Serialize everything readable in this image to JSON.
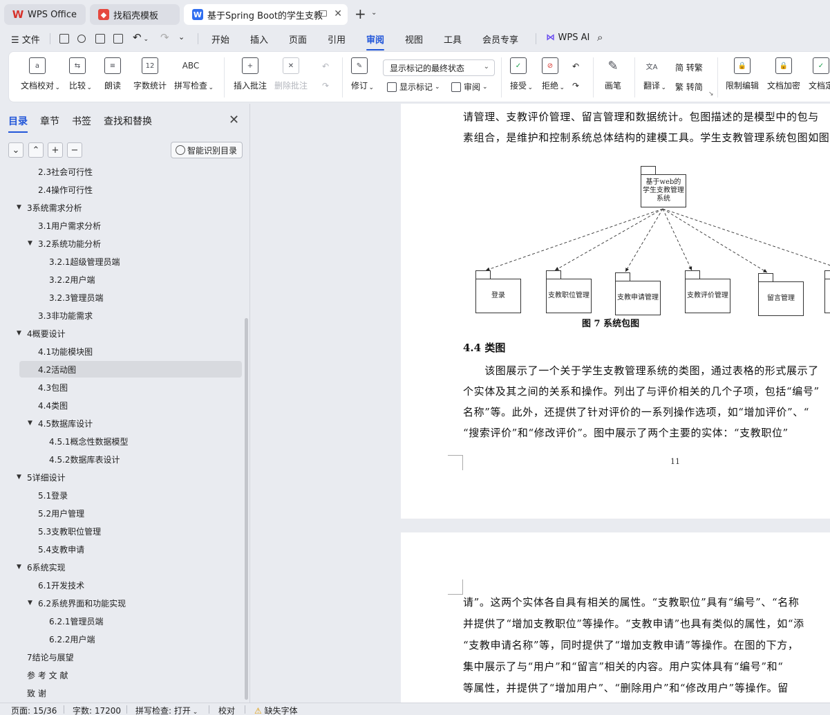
{
  "tabs": {
    "wps_office": "WPS Office",
    "templates": "找稻壳模板",
    "document": "基于Spring Boot的学生支教管"
  },
  "menu": {
    "file": "文件",
    "items": [
      "开始",
      "插入",
      "页面",
      "引用",
      "审阅",
      "视图",
      "工具",
      "会员专享"
    ],
    "active": "审阅",
    "wps_ai": "WPS AI"
  },
  "ribbon": {
    "doc_check": "文档校对",
    "compare": "比较",
    "read_aloud": "朗读",
    "word_count": "字数统计",
    "word_count_icon_text": "12",
    "spell_check": "拼写检查",
    "spell_icon_text": "ABC",
    "insert_comment": "插入批注",
    "delete_comment": "删除批注",
    "revise": "修订",
    "mark_state": "显示标记的最终状态",
    "show_marks": "显示标记",
    "review": "审阅",
    "accept": "接受",
    "reject": "拒绝",
    "pen": "画笔",
    "translate": "翻译",
    "to_traditional": "简 转繁",
    "to_simplified": "繁 转简",
    "restrict_edit": "限制编辑",
    "doc_encrypt": "文档加密",
    "doc_final": "文档定"
  },
  "sidebar": {
    "tabs": [
      "目录",
      "章节",
      "书签",
      "查找和替换"
    ],
    "smart_toc": "智能识别目录",
    "toc": [
      {
        "text": "2.3社会可行性",
        "level": 2
      },
      {
        "text": "2.4操作可行性",
        "level": 2
      },
      {
        "text": "3系统需求分析",
        "level": 1,
        "arrow": true
      },
      {
        "text": "3.1用户需求分析",
        "level": 2
      },
      {
        "text": "3.2系统功能分析",
        "level": 2,
        "arrow": true
      },
      {
        "text": "3.2.1超级管理员端",
        "level": 3
      },
      {
        "text": "3.2.2用户端",
        "level": 3
      },
      {
        "text": "3.2.3管理员端",
        "level": 3
      },
      {
        "text": "3.3非功能需求",
        "level": 2
      },
      {
        "text": "4概要设计",
        "level": 1,
        "arrow": true
      },
      {
        "text": "4.1功能模块图",
        "level": 2
      },
      {
        "text": "4.2活动图",
        "level": 2,
        "selected": true
      },
      {
        "text": "4.3包图",
        "level": 2
      },
      {
        "text": "4.4类图",
        "level": 2
      },
      {
        "text": "4.5数据库设计",
        "level": 2,
        "arrow": true
      },
      {
        "text": "4.5.1概念性数据模型",
        "level": 3
      },
      {
        "text": "4.5.2数据库表设计",
        "level": 3
      },
      {
        "text": "5详细设计",
        "level": 1,
        "arrow": true
      },
      {
        "text": "5.1登录",
        "level": 2
      },
      {
        "text": "5.2用户管理",
        "level": 2
      },
      {
        "text": "5.3支教职位管理",
        "level": 2
      },
      {
        "text": "5.4支教申请",
        "level": 2
      },
      {
        "text": "6系统实现",
        "level": 1,
        "arrow": true
      },
      {
        "text": "6.1开发技术",
        "level": 2
      },
      {
        "text": "6.2系统界面和功能实现",
        "level": 2,
        "arrow": true
      },
      {
        "text": "6.2.1管理员端",
        "level": 3
      },
      {
        "text": "6.2.2用户端",
        "level": 3
      },
      {
        "text": "7结论与展望",
        "level": 1
      },
      {
        "text": "参 考 文 献",
        "level": 1
      },
      {
        "text": "致          谢",
        "level": 1
      }
    ]
  },
  "document": {
    "page1_lines": [
      "请管理、支教评价管理、留言管理和数据统计。包图描述的是模型中的包与",
      "素组合，是维护和控制系统总体结构的建模工具。学生支教管理系统包图如图"
    ],
    "diagram": {
      "root": "基于web的学生支教管理系统",
      "children": [
        "登录",
        "支教职位管理",
        "支教申请管理",
        "支教评价管理",
        "留言管理"
      ]
    },
    "figure_caption": "图 7  系统包图",
    "section_title": "4.4  类图",
    "para_lines": [
      "　　该图展示了一个关于学生支教管理系统的类图，通过表格的形式展示了",
      "个实体及其之间的关系和操作。列出了与评价相关的几个子项，包括“编号”",
      "名称”等。此外，还提供了针对评价的一系列操作选项，如“增加评价”、“",
      "“搜索评价”和“修改评价”。图中展示了两个主要的实体：“支教职位”"
    ],
    "page_number": "11",
    "page2_lines": [
      "请”。这两个实体各自具有相关的属性。“支教职位”具有“编号”、“名称",
      "并提供了“增加支教职位”等操作。“支教申请”也具有类似的属性，如“添",
      "“支教申请名称”等，同时提供了“增加支教申请”等操作。在图的下方，",
      "集中展示了与“用户”和“留言”相关的内容。用户实体具有“编号”和“",
      "等属性，并提供了“增加用户”、“删除用户”和“修改用户”等操作。留"
    ]
  },
  "status": {
    "page": "页面: 15/36",
    "words": "字数: 17200",
    "spell": "拼写检查: 打开",
    "proof": "校对",
    "missing_font": "缺失字体"
  },
  "colors": {
    "accent": "#2156d9",
    "chrome_bg": "#e9ebf0",
    "wps_red": "#d7322b"
  }
}
